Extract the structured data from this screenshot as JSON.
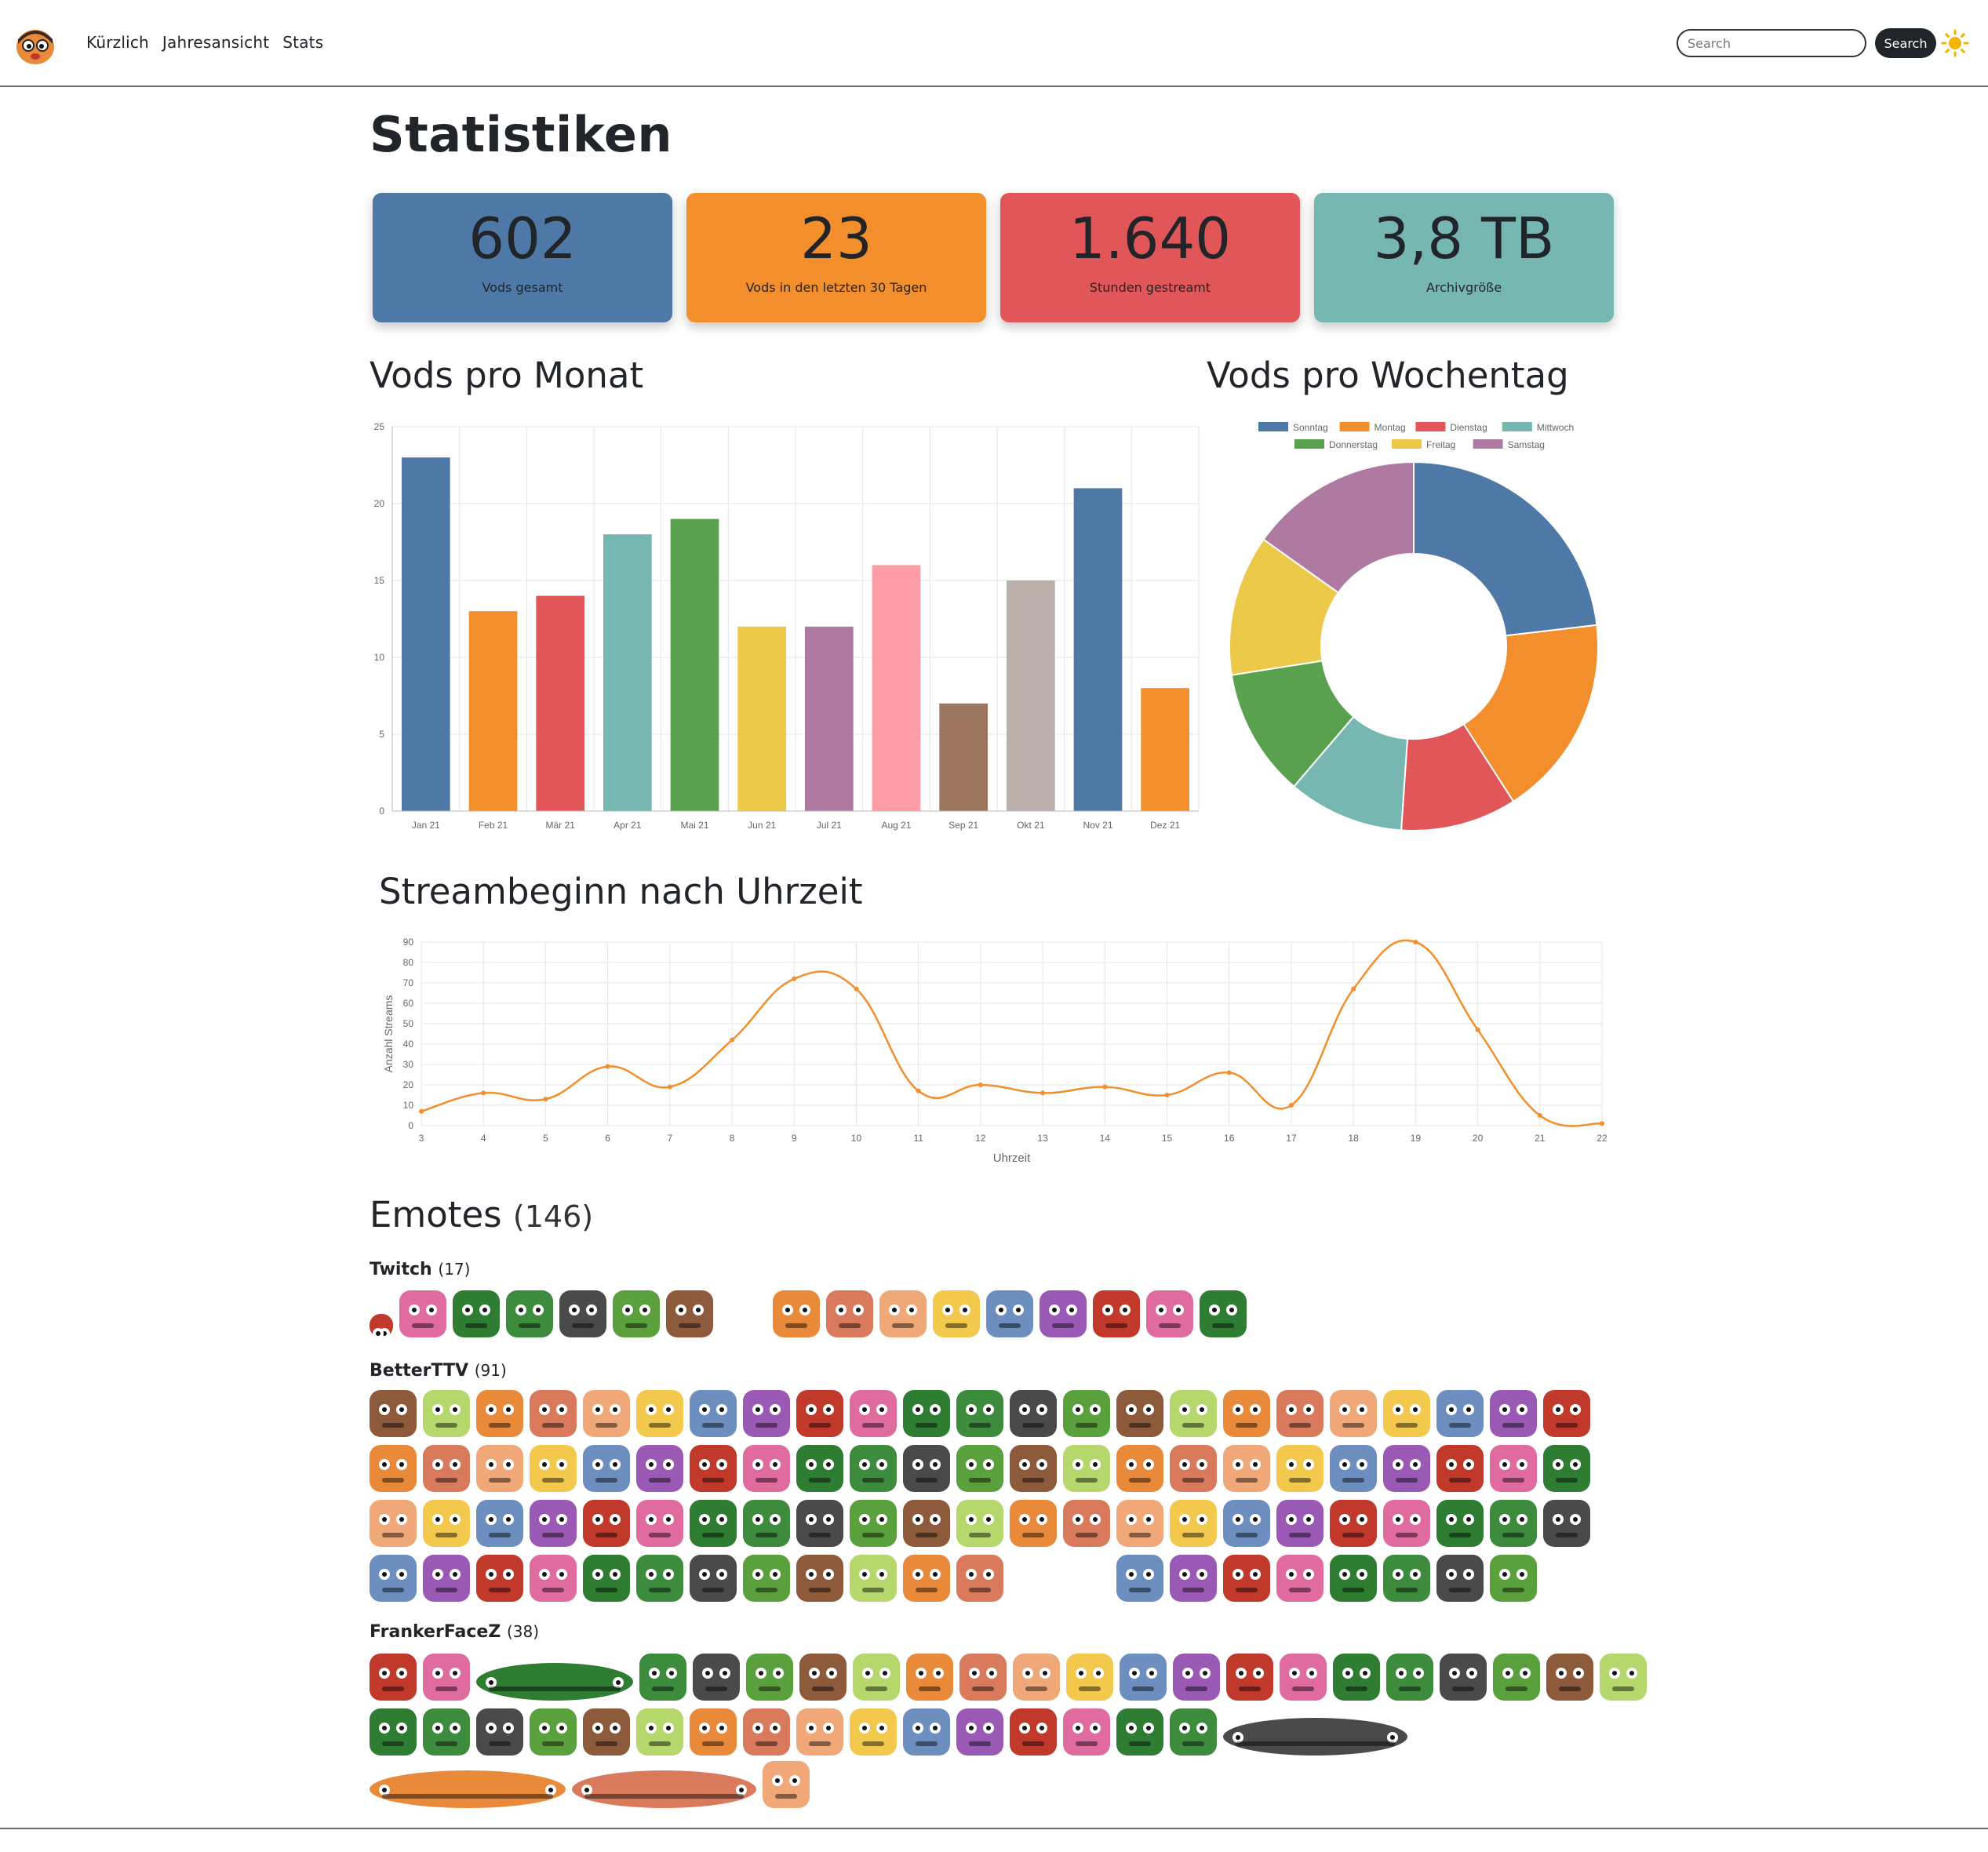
{
  "nav": {
    "links": [
      "Kürzlich",
      "Jahresansicht",
      "Stats"
    ],
    "search_placeholder": "Search",
    "search_button": "Search",
    "theme_icon": "sun-icon"
  },
  "page": {
    "title": "Statistiken"
  },
  "stats": [
    {
      "value": "602",
      "label": "Vods gesamt",
      "color": "#4e79a7"
    },
    {
      "value": "23",
      "label": "Vods in den letzten 30 Tagen",
      "color": "#f28e2c"
    },
    {
      "value": "1.640",
      "label": "Stunden gestreamt",
      "color": "#e15759"
    },
    {
      "value": "3,8 TB",
      "label": "Archivgröße",
      "color": "#76b7b2"
    }
  ],
  "sections": {
    "monthly": "Vods pro Monat",
    "weekday": "Vods pro Wochentag",
    "hourly": "Streambeginn nach Uhrzeit"
  },
  "chart_data": [
    {
      "type": "bar",
      "categories": [
        "Jan 21",
        "Feb 21",
        "Mär 21",
        "Apr 21",
        "Mai 21",
        "Jun 21",
        "Jul 21",
        "Aug 21",
        "Sep 21",
        "Okt 21",
        "Nov 21",
        "Dez 21"
      ],
      "values": [
        23,
        13,
        14,
        18,
        19,
        12,
        12,
        16,
        7,
        15,
        21,
        8
      ],
      "colors": [
        "#4e79a7",
        "#f28e2c",
        "#e15759",
        "#76b7b2",
        "#59a14f",
        "#edc949",
        "#af7aa1",
        "#ff9da7",
        "#9c755f",
        "#bab0ab",
        "#4e79a7",
        "#f28e2c"
      ],
      "yticks": [
        0,
        5,
        10,
        15,
        20,
        25
      ],
      "ylim": [
        0,
        25
      ],
      "grid": true
    },
    {
      "type": "pie",
      "labels": [
        "Sonntag",
        "Montag",
        "Dienstag",
        "Mittwoch",
        "Donnerstag",
        "Freitag",
        "Samstag"
      ],
      "values": [
        107,
        82,
        47,
        47,
        52,
        57,
        70
      ],
      "colors": [
        "#4e79a7",
        "#f28e2c",
        "#e15759",
        "#76b7b2",
        "#59a14f",
        "#edc949",
        "#af7aa1"
      ],
      "legend": "top"
    },
    {
      "type": "line",
      "x": [
        3,
        4,
        5,
        6,
        7,
        8,
        9,
        10,
        11,
        12,
        13,
        14,
        15,
        16,
        17,
        18,
        19,
        20,
        21,
        22
      ],
      "values": [
        7,
        16,
        13,
        29,
        19,
        42,
        72,
        67,
        17,
        20,
        16,
        19,
        15,
        26,
        10,
        67,
        90,
        47,
        5,
        1
      ],
      "color": "#f28e2c",
      "xlabel": "Uhrzeit",
      "ylabel": "Anzahl Streams",
      "yticks": [
        0,
        10,
        20,
        30,
        40,
        50,
        60,
        70,
        80,
        90
      ],
      "ylim": [
        0,
        90
      ],
      "grid": true
    }
  ],
  "emotes": {
    "title": "Emotes",
    "total": "(146)",
    "groups": [
      {
        "name": "Twitch",
        "count": "(17)"
      },
      {
        "name": "BetterTTV",
        "count": "(91)"
      },
      {
        "name": "FrankerFaceZ",
        "count": "(38)"
      }
    ]
  }
}
